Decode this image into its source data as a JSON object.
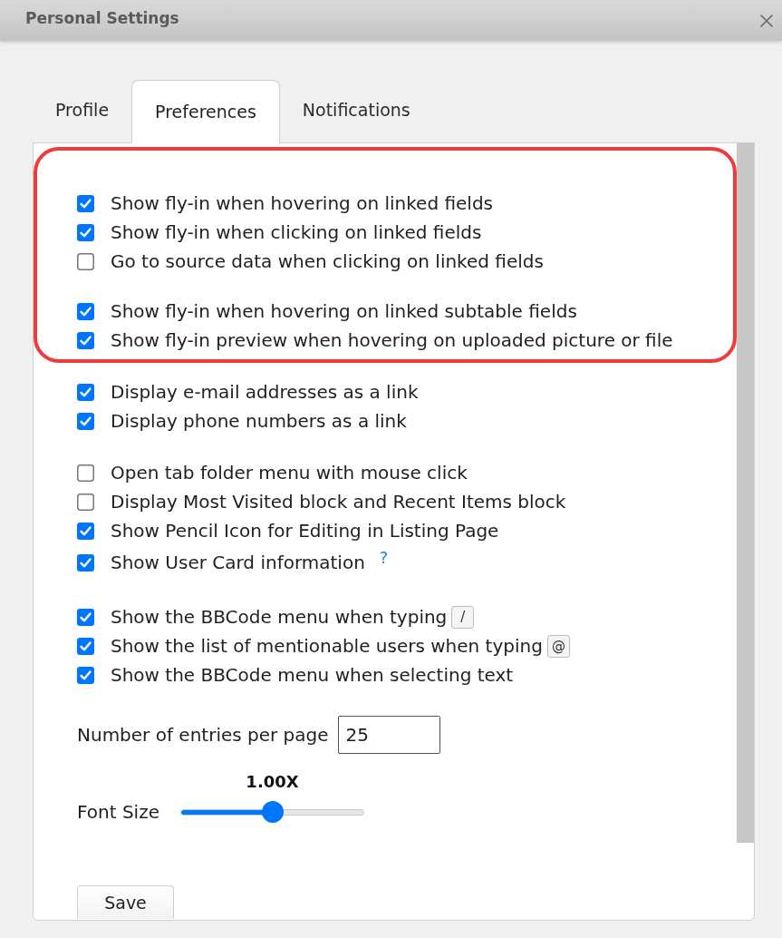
{
  "window": {
    "title": "Personal Settings"
  },
  "tabs": [
    {
      "label": "Profile",
      "selected": false
    },
    {
      "label": "Preferences",
      "selected": true
    },
    {
      "label": "Notifications",
      "selected": false
    }
  ],
  "sections": [
    {
      "highlighted": true,
      "groups": [
        {
          "items": [
            {
              "label": "Show fly-in when hovering on linked fields",
              "checked": true
            },
            {
              "label": "Show fly-in when clicking on linked fields",
              "checked": true
            },
            {
              "label": "Go to source data when clicking on linked fields",
              "checked": false
            }
          ]
        },
        {
          "items": [
            {
              "label": "Show fly-in when hovering on linked subtable fields",
              "checked": true
            },
            {
              "label": "Show fly-in preview when hovering on uploaded picture or file",
              "checked": true
            }
          ]
        }
      ]
    },
    {
      "highlighted": false,
      "groups": [
        {
          "items": [
            {
              "label": "Display e-mail addresses as a link",
              "checked": true
            },
            {
              "label": "Display phone numbers as a link",
              "checked": true
            }
          ]
        },
        {
          "items": [
            {
              "label": "Open tab folder menu with mouse click",
              "checked": false
            },
            {
              "label": "Display Most Visited block and Recent Items block",
              "checked": false
            },
            {
              "label": "Show Pencil Icon for Editing in Listing Page",
              "checked": true
            },
            {
              "label": "Show User Card information",
              "checked": true,
              "help": "?"
            }
          ]
        },
        {
          "items": [
            {
              "label": "Show the BBCode menu when typing",
              "checked": true,
              "key": "/"
            },
            {
              "label": "Show the list of mentionable users when typing",
              "checked": true,
              "key": "@"
            },
            {
              "label": "Show the BBCode menu when selecting text",
              "checked": true
            }
          ]
        }
      ]
    }
  ],
  "entries_per_page": {
    "label": "Number of entries per page",
    "value": "25"
  },
  "font_size": {
    "label": "Font Size",
    "reading": "1.00X",
    "level": 0.5
  },
  "save_button": {
    "label": "Save"
  }
}
